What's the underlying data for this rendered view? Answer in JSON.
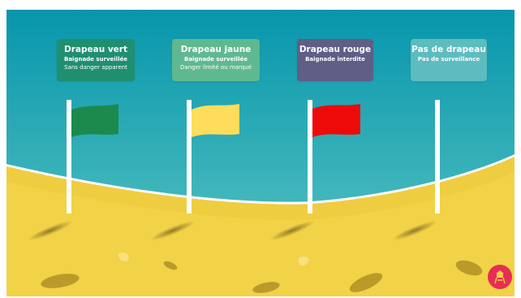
{
  "colors": {
    "sea_top": "#0796ac",
    "sea_bottom": "#5ec7c3",
    "sand": "#f2d246",
    "flag_green": "#1c8a4c",
    "flag_yellow": "#fedd5d",
    "flag_red": "#ef0a0a",
    "card_green": "#1f8f70",
    "card_yellow": "#5fb990",
    "card_red": "#5f5e87",
    "card_none": "#5dbcbf",
    "logo": "#e62d54"
  },
  "flags": [
    {
      "id": "green",
      "title": "Drapeau vert",
      "line1": "Baignade surveillée",
      "line2": "Sans danger apparent",
      "flag_icon": "green-flag-icon"
    },
    {
      "id": "yellow",
      "title": "Drapeau jaune",
      "line1": "Baignade surveillée",
      "line2": "Danger limité ou marqué",
      "flag_icon": "yellow-flag-icon"
    },
    {
      "id": "red",
      "title": "Drapeau rouge",
      "line1": "Baignade interdite",
      "line2": "",
      "flag_icon": "red-flag-icon"
    },
    {
      "id": "none",
      "title": "Pas de drapeau",
      "line1": "Pas de surveillance",
      "line2": "",
      "flag_icon": "empty-pole-icon"
    }
  ],
  "logo": {
    "icon": "lifeguard-tower-icon"
  }
}
